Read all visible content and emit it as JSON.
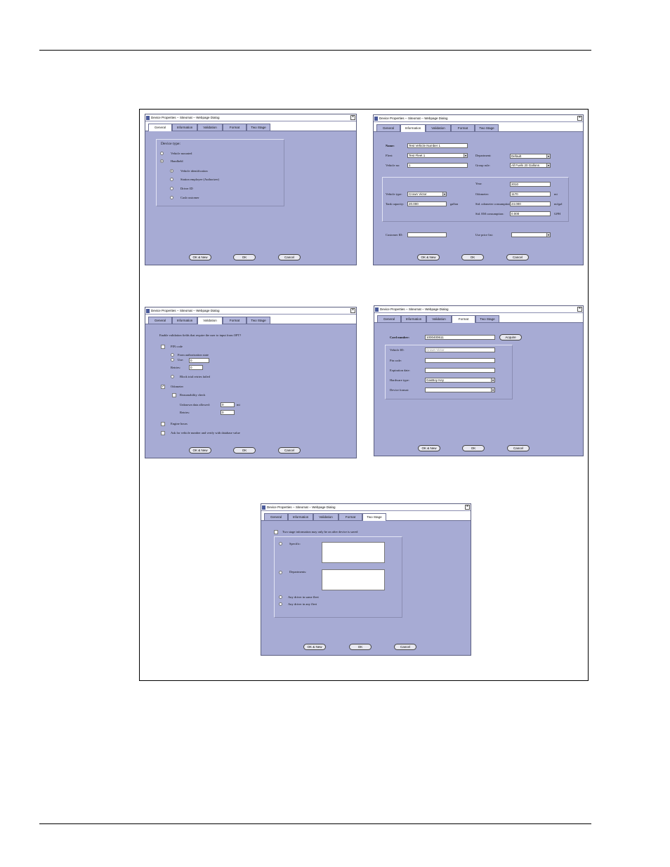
{
  "dialog_title": "Device Properties -- Siteomat -- Webpage Dialog",
  "close_glyph": "×",
  "check_glyph": "✓",
  "tabs": [
    "General",
    "Information",
    "Validation",
    "Format",
    "Two Stage"
  ],
  "buttons": {
    "ok_new": "OK & New",
    "ok": "OK",
    "cancel": "Cancel",
    "acquire": "Acquire"
  },
  "general": {
    "device_type_label": "Device type:",
    "vehicle_mounted": "Vehicle mounted",
    "handheld": "Handheld",
    "options": [
      "Vehicle identification",
      "Station employee (Authorizer)",
      "Driver ID",
      "Cash customer"
    ]
  },
  "information": {
    "name_label": "Name:",
    "name_value": "Test Vehicle Number 1",
    "fleet_label": "Fleet:",
    "fleet_value": "Test Fleet 1",
    "vehicle_no_label": "Vehicle no:",
    "vehicle_no_value": "1",
    "department_label": "Department:",
    "department_value": "Default",
    "group_rule_label": "Group rule:",
    "group_rule_value": "All Fuels 20 Gallons",
    "year_label": "Year:",
    "year_value": "2010",
    "vehicle_type_label": "Vehicle type:",
    "vehicle_type_value": "Crown Victor",
    "odometer_label": "Odometer:",
    "odometer_value": "1170",
    "odometer_unit": "mi",
    "tank_capacity_label": "Tank capacity:",
    "tank_capacity_value": "20.000",
    "tank_capacity_unit": "gallon",
    "std_odometer_label": "Std. odometer consumption:",
    "std_odometer_value": "24.000",
    "std_odometer_unit": "mi/gal",
    "std_em_label": "Std. EM consumption:",
    "std_em_value": "0.000",
    "std_em_unit": "GPH",
    "customer_id_label": "Customer ID:",
    "customer_id_value": "",
    "price_list_label": "Use price list:",
    "price_list_value": ""
  },
  "validation": {
    "question": "Enable validation fields that require the user to input from OPT?",
    "pin_code": "PIN code",
    "from_authorization": "From authorization state",
    "use_label": "Use:",
    "use_value": "0",
    "retries_label": "Retries:",
    "retries_value": "0",
    "block_retries": "Block trial retries failed",
    "odometer": "Odometer",
    "reasonability": "Reasonability check",
    "unknown_label": "Unknown data allowed:",
    "unknown_value": "0",
    "unknown_unit": "mi",
    "odo_retries_label": "Retries:",
    "odo_retries_value": "0",
    "engine_hours": "Engine hours",
    "ask_vehicle": "Ask for vehicle number and verify with database value"
  },
  "format": {
    "card_number_label": "Card number:",
    "card_number_value": "1000400611",
    "vehicle_id_label": "Vehicle ID:",
    "vehicle_id_value": "Crown Victor",
    "pin_code_label": "Pin code:",
    "expiration_label": "Expiration date:",
    "hardware_type_label": "Hardware type:",
    "hardware_type_value": "GasBoy Key",
    "device_format_label": "Device format:"
  },
  "two_stage": {
    "intro": "Two stage information may only be on after device is saved",
    "specific": "Specific:",
    "departments": "Departments:",
    "any_same_fleet": "Any driver in same fleet",
    "any_any_fleet": "Any driver in any fleet"
  }
}
